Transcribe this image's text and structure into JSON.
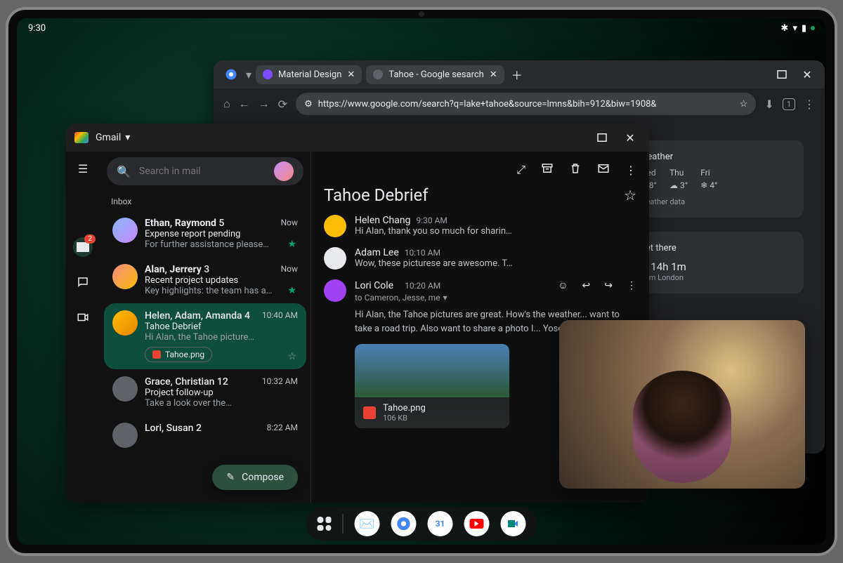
{
  "status": {
    "time": "9:30"
  },
  "chrome": {
    "tabs": [
      {
        "label": "Material Design"
      },
      {
        "label": "Tahoe - Google sesarch"
      }
    ],
    "url": "https://www.google.com/search?q=lake+tahoe&source=lmns&bih=912&biw=1908&",
    "badge_count": "1",
    "weather": {
      "title": "Weather",
      "days": [
        {
          "d": "Wed",
          "t": "8°"
        },
        {
          "d": "Thu",
          "t": "3°"
        },
        {
          "d": "Fri",
          "t": "4°"
        }
      ],
      "footer": "Weather data"
    },
    "getthere": {
      "title": "Get there",
      "duration": "14h 1m",
      "from": "from London"
    }
  },
  "gmail": {
    "app_name": "Gmail",
    "search_placeholder": "Search in mail",
    "inbox_label": "Inbox",
    "badge": "2",
    "compose": "Compose",
    "threads": [
      {
        "senders": "Ethan, Raymond",
        "count": "5",
        "time": "Now",
        "subject": "Expense report pending",
        "snippet": "For further assistance please…",
        "starred": true
      },
      {
        "senders": "Alan, Jerrery",
        "count": "3",
        "time": "Now",
        "subject": "Recent project updates",
        "snippet": "Key highlights: the team has a…",
        "starred": true
      },
      {
        "senders": "Helen, Adam, Amanda",
        "count": "4",
        "time": "10:40 AM",
        "subject": "Tahoe Debrief",
        "snippet": "Hi Alan, the Tahoe picture…",
        "attachment": "Tahoe.png",
        "selected": true
      },
      {
        "senders": "Grace, Christian",
        "count": "12",
        "time": "10:32 AM",
        "subject": "Project follow-up",
        "snippet": "Take a look over the…"
      },
      {
        "senders": "Lori, Susan",
        "count": "2",
        "time": "8:22 AM",
        "subject": "",
        "snippet": ""
      }
    ],
    "reader": {
      "title": "Tahoe Debrief",
      "messages": [
        {
          "from": "Helen Chang",
          "time": "9:30 AM",
          "text": "Hi Alan, thank you so much for sharin…"
        },
        {
          "from": "Adam Lee",
          "time": "10:10 AM",
          "text": "Wow, these picturese are awesome. T…"
        },
        {
          "from": "Lori Cole",
          "time": "10:20 AM",
          "recipients": "to Cameron, Jesse, me",
          "text": "Hi Alan, the Tahoe pictures are great. How's the weather... want to take a road trip. Also want to share a photo I... Yosemite.",
          "expanded": true
        }
      ],
      "attachment_name": "Tahoe.png",
      "attachment_size": "106 KB"
    }
  },
  "taskbar": {
    "apps": [
      "gmail",
      "chrome",
      "calendar",
      "youtube",
      "meet"
    ]
  }
}
